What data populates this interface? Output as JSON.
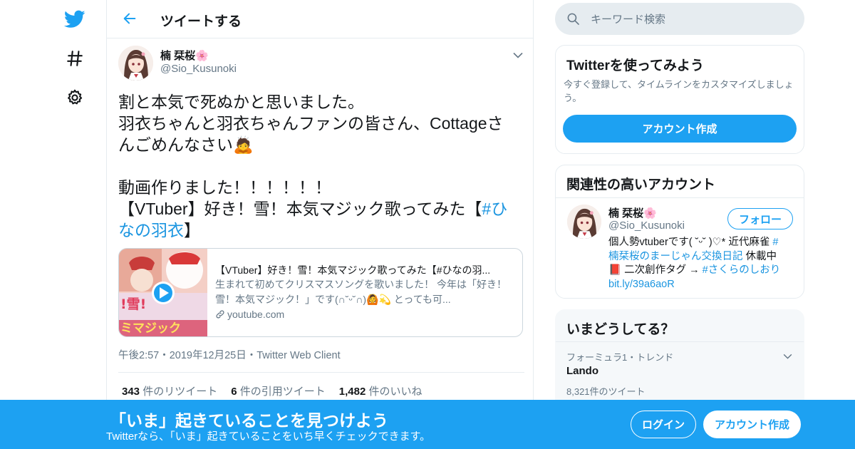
{
  "colors": {
    "brand": "#1da1f2",
    "link": "#1b95e0",
    "text_primary": "#14171a",
    "text_secondary": "#657786",
    "border": "#e6ecf0"
  },
  "left_nav": {
    "items": [
      {
        "icon": "twitter-bird-icon"
      },
      {
        "icon": "hashtag-icon"
      },
      {
        "icon": "gear-icon"
      }
    ]
  },
  "header": {
    "title": "ツイートする"
  },
  "tweet": {
    "author_name": "楠 栞桜🌸",
    "author_handle": "@Sio_Kusunoki",
    "text_lines": [
      "割と本気で死ぬかと思いました。",
      "羽衣ちゃんと羽衣ちゃんファンの皆さん、Cottageさ",
      "んごめんなさい🙇"
    ],
    "text_line_4": "動画作りました！！！！！！",
    "text_line_5_prefix": "【VTuber】好き！雪！本気マジック歌ってみた【",
    "hashtag_part1": "#ひ",
    "hashtag_part2": "なの羽衣",
    "text_line_6_suffix": "】",
    "card": {
      "title": "【VTuber】好き！雪！本気マジック歌ってみた【#ひなの羽...",
      "description": "生まれて初めてクリスマスソングを歌いました！ 今年は「好き！雪！本気マジック！」です(∩˘ᵕ˘∩)🙆💫 とっても可...",
      "domain": "youtube.com",
      "thumb_text_1": "!雪!",
      "thumb_text_2": "ミマジック"
    },
    "timestamp": "午後2:57・2019年12月25日・Twitter Web Client",
    "stats": {
      "retweets_count": "343",
      "retweets_label": "件のリツイート",
      "quotes_count": "6",
      "quotes_label": "件の引用ツイート",
      "likes_count": "1,482",
      "likes_label": "件のいいね"
    }
  },
  "search": {
    "placeholder": "キーワード検索"
  },
  "signup_panel": {
    "title": "Twitterを使ってみよう",
    "description": "今すぐ登録して、タイムラインをカスタマイズしましょう。",
    "button_label": "アカウント作成"
  },
  "related_panel": {
    "title": "関連性の高いアカウント",
    "account": {
      "name": "楠 栞桜🌸",
      "handle": "@Sio_Kusunoki",
      "follow_label": "フォロー",
      "bio_line1": "個人勢vtuberです( ˘ᵕ˘ )♡* 近代麻雀 ",
      "bio_tag1a": "#",
      "bio_tag1b": "楠栞桜のまーじゃん交換日記",
      "bio_line2_suffix": " 休載中",
      "bio_line3_prefix": "📕 二次創作タグ → ",
      "bio_tag2": "#さくらのしおり",
      "bio_link": "bit.ly/39a6aoR"
    }
  },
  "trends_panel": {
    "title": "いまどうしてる？",
    "trend": {
      "context": "フォーミュラ1・トレンド",
      "name": "Lando",
      "count": "8,321件のツイート"
    }
  },
  "bottom_banner": {
    "title": "「いま」起きていることを見つけよう",
    "subtitle": "Twitterなら、「いま」起きていることをいち早くチェックできます。",
    "login_label": "ログイン",
    "signup_label": "アカウント作成"
  }
}
